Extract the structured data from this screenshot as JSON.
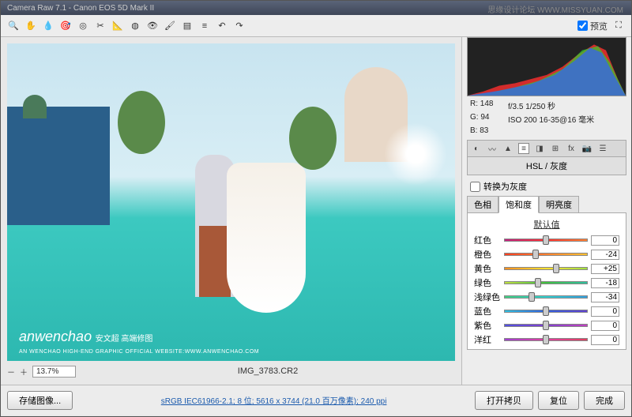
{
  "window": {
    "title": "Camera Raw 7.1  -  Canon EOS 5D Mark II"
  },
  "watermark": "思缘设计论坛  WWW.MISSYUAN.COM",
  "preview_label": "预览",
  "zoom": {
    "value": "13.7%"
  },
  "filename": "IMG_3783.CR2",
  "info": {
    "r": "R:   148",
    "g": "G:    94",
    "b": "B:    83",
    "exposure": "f/3.5   1/250 秒",
    "iso": "ISO 200   16-35@16 毫米"
  },
  "panel": {
    "title": "HSL / 灰度",
    "grayscale_label": "转换为灰度"
  },
  "hsl_tabs": {
    "hue": "色相",
    "sat": "饱和度",
    "lum": "明亮度"
  },
  "default_label": "默认值",
  "sliders": [
    {
      "label": "红色",
      "value": 0,
      "grad": "linear-gradient(to right,#c02080,#ff3030,#ff8030)"
    },
    {
      "label": "橙色",
      "value": -24,
      "grad": "linear-gradient(to right,#ff4020,#ff8030,#ffc030)"
    },
    {
      "label": "黄色",
      "value": 25,
      "grad": "linear-gradient(to right,#ff9020,#ffe030,#a0e040)"
    },
    {
      "label": "绿色",
      "value": -18,
      "grad": "linear-gradient(to right,#c0e040,#40c040,#30c0a0)"
    },
    {
      "label": "浅绿色",
      "value": -34,
      "grad": "linear-gradient(to right,#40d080,#30d0d0,#30a0e0)"
    },
    {
      "label": "蓝色",
      "value": 0,
      "grad": "linear-gradient(to right,#30c0e0,#3060e0,#6040d0)"
    },
    {
      "label": "紫色",
      "value": 0,
      "grad": "linear-gradient(to right,#5050e0,#8040d0,#c040c0)"
    },
    {
      "label": "洋红",
      "value": 0,
      "grad": "linear-gradient(to right,#a040d0,#e040a0,#e04060)"
    }
  ],
  "buttons": {
    "save_image": "存储图像...",
    "open_copy": "打开拷贝",
    "reset": "复位",
    "done": "完成"
  },
  "meta_link": "sRGB IEC61966-2.1; 8 位;  5616 x 3744 (21.0 百万像素); 240 ppi",
  "photo_wm": {
    "main": "anwenchao",
    "cn": "安文超 高端修图",
    "sub": "AN WENCHAO HIGH-END GRAPHIC OFFICIAL WEBSITE:WWW.ANWENCHAO.COM"
  }
}
